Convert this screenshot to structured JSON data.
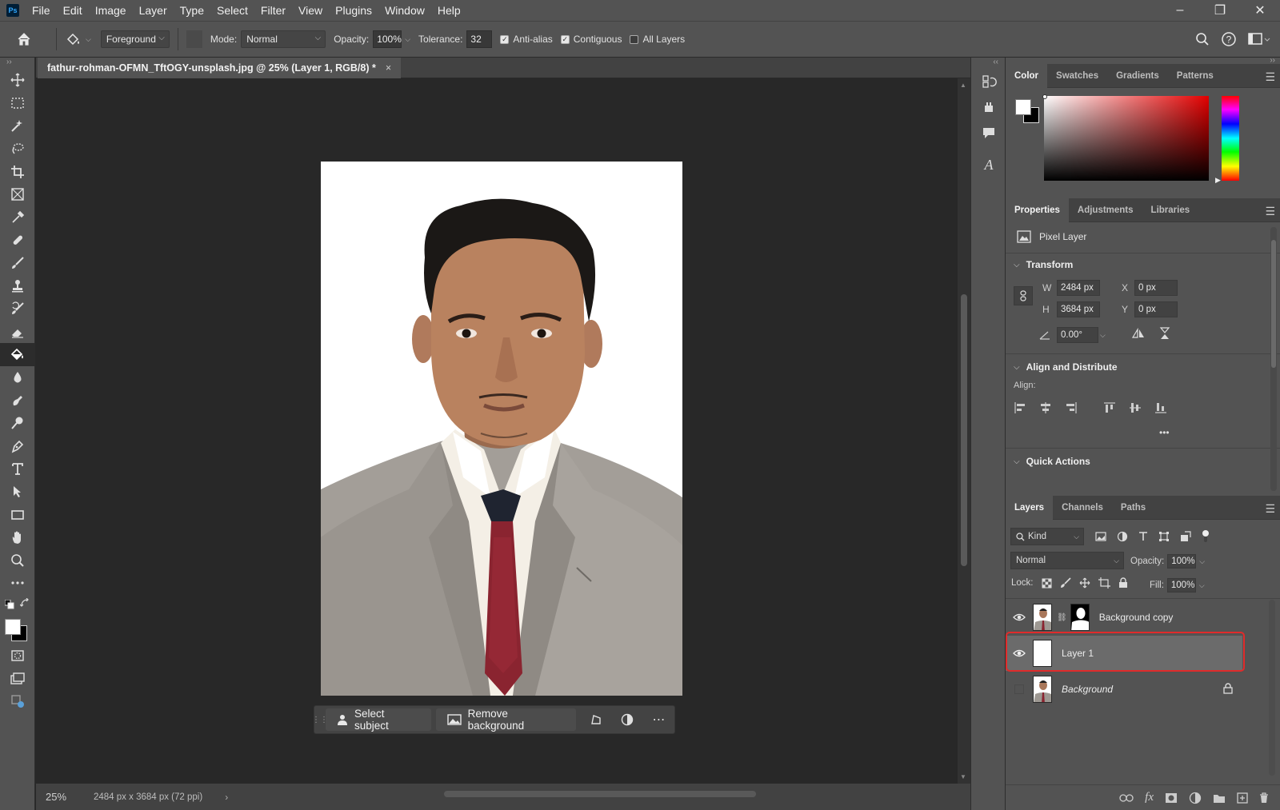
{
  "menubar": {
    "app_logo": "Ps",
    "items": [
      "File",
      "Edit",
      "Image",
      "Layer",
      "Type",
      "Select",
      "Filter",
      "View",
      "Plugins",
      "Window",
      "Help"
    ],
    "minimize": "–",
    "restore": "❐",
    "close": "✕"
  },
  "options": {
    "fill_source": "Foreground",
    "mode_label": "Mode:",
    "mode_value": "Normal",
    "opacity_label": "Opacity:",
    "opacity_value": "100%",
    "tolerance_label": "Tolerance:",
    "tolerance_value": "32",
    "anti_alias": "Anti-alias",
    "contiguous": "Contiguous",
    "all_layers": "All Layers",
    "anti_alias_checked": true,
    "contiguous_checked": true,
    "all_layers_checked": false
  },
  "document": {
    "tab_title": "fathur-rohman-OFMN_TftOGY-unsplash.jpg @ 25% (Layer 1, RGB/8) *",
    "close": "×"
  },
  "taskbar": {
    "select_subject": "Select subject",
    "remove_background": "Remove background",
    "more": "⋯"
  },
  "status": {
    "zoom": "25%",
    "doc_info": "2484 px x 3684 px (72 ppi)",
    "arrow": "›"
  },
  "color_panel": {
    "tabs": [
      "Color",
      "Swatches",
      "Gradients",
      "Patterns"
    ],
    "foreground": "#ffffff",
    "background": "#000000"
  },
  "properties_panel": {
    "tabs": [
      "Properties",
      "Adjustments",
      "Libraries"
    ],
    "layer_type": "Pixel Layer",
    "transform_title": "Transform",
    "w_label": "W",
    "w_value": "2484 px",
    "h_label": "H",
    "h_value": "3684 px",
    "x_label": "X",
    "x_value": "0 px",
    "y_label": "Y",
    "y_value": "0 px",
    "angle_value": "0.00°",
    "align_title": "Align and Distribute",
    "align_label": "Align:",
    "quick_actions_title": "Quick Actions",
    "more": "•••"
  },
  "layers_panel": {
    "tabs": [
      "Layers",
      "Channels",
      "Paths"
    ],
    "filter_kind": "Kind",
    "blend_mode": "Normal",
    "opacity_label": "Opacity:",
    "opacity_value": "100%",
    "lock_label": "Lock:",
    "fill_label": "Fill:",
    "fill_value": "100%",
    "layers": [
      {
        "name": "Background copy",
        "visible": true
      },
      {
        "name": "Layer 1",
        "visible": true,
        "selected": true
      },
      {
        "name": "Background",
        "visible": false,
        "locked": true
      }
    ],
    "footer_fx": "fx"
  },
  "colors": {
    "ui_bg": "#535353",
    "canvas_bg": "#282828",
    "highlight": "#e02b2b"
  }
}
